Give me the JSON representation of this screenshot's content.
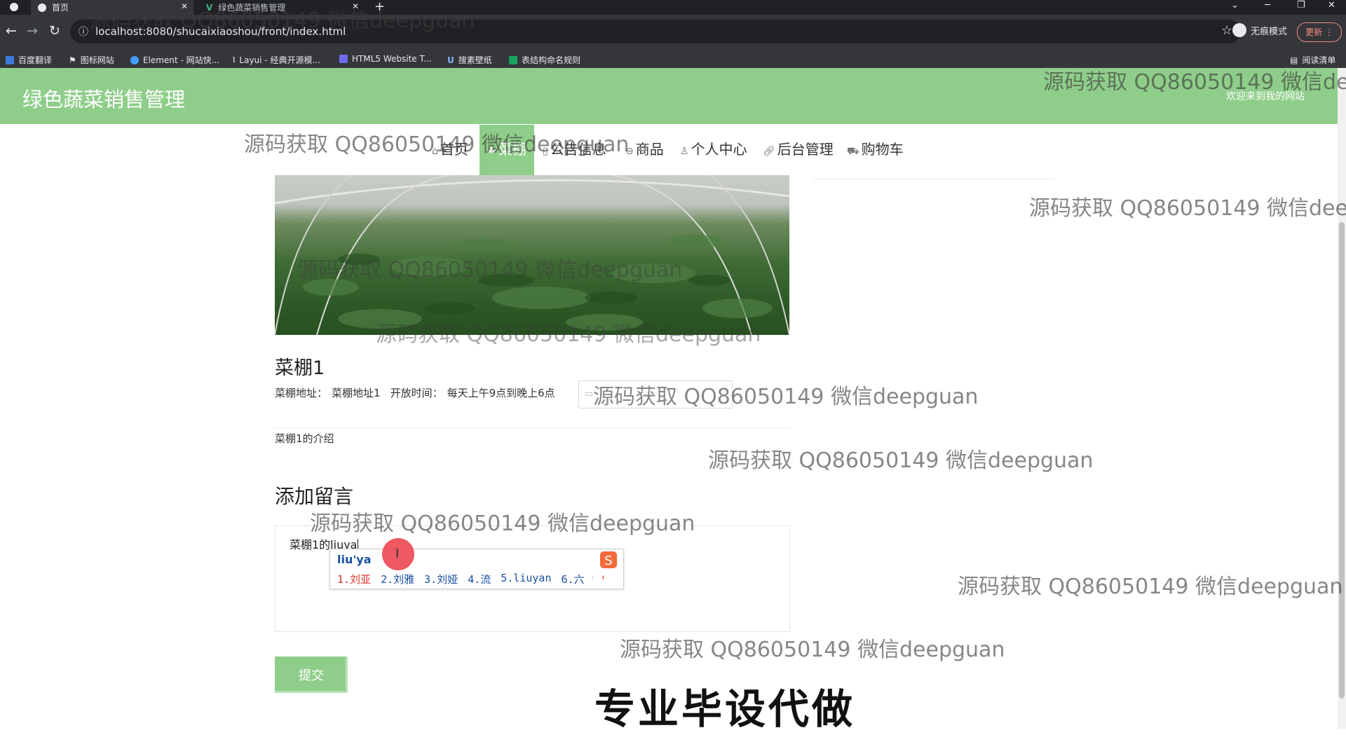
{
  "browser": {
    "tabs": [
      {
        "title": "首页",
        "active": true
      },
      {
        "title": "绿色蔬菜销售管理",
        "active": false
      }
    ],
    "url": "localhost:8080/shucaixiaoshou/front/index.html",
    "incognito_label": "无痕模式",
    "update_label": "更新",
    "reading_list_label": "阅读清单",
    "bookmarks": [
      {
        "label": "百度翻译",
        "color": "#3b7ddd"
      },
      {
        "label": "图标网站",
        "color": "#e8eaed"
      },
      {
        "label": "Element - 网站快...",
        "color": "#409eff"
      },
      {
        "label": "Layui - 经典开源模...",
        "color": "#e8eaed"
      },
      {
        "label": "HTML5 Website T...",
        "color": "#6c6cf0"
      },
      {
        "label": "搜素壁纸",
        "color": "#3367d6"
      },
      {
        "label": "表结构命名规则",
        "color": "#1aa260"
      }
    ]
  },
  "site": {
    "title": "绿色蔬菜销售管理",
    "welcome": "欢迎来到我的网站",
    "accent": "#8fce8a",
    "nav": [
      {
        "label": "首页",
        "icon": "home-icon",
        "active": false
      },
      {
        "label": "菜棚",
        "icon": "leaf-icon",
        "active": true
      },
      {
        "label": "公告信息",
        "icon": "book-icon",
        "active": false
      },
      {
        "label": "商品",
        "icon": "box-icon",
        "active": false
      },
      {
        "label": "个人中心",
        "icon": "user-icon",
        "active": false
      },
      {
        "label": "后台管理",
        "icon": "link-icon",
        "active": false
      },
      {
        "label": "购物车",
        "icon": "cart-icon",
        "active": false
      }
    ]
  },
  "detail": {
    "name": "菜棚1",
    "address_label": "菜棚地址：",
    "address_value": "菜棚地址1",
    "hours_label": "开放时间：",
    "hours_value": "每天上午9点到晚上6点",
    "intro": "菜棚1的介绍"
  },
  "message": {
    "title": "添加留言",
    "input_value": "菜棚1的liuya",
    "submit_label": "提交"
  },
  "ime": {
    "pinyin": "liu'ya",
    "candidates": [
      "1.刘亚",
      "2.刘雅",
      "3.刘娅",
      "4.流",
      "5.liuyan",
      "6.六"
    ]
  },
  "watermarks": [
    "源码获取 QQ86050149 微信deepguan",
    "源码获取 QQ86050149 微信dee",
    "源码获取 QQ86050149 微信dee"
  ],
  "promo": "专业毕设代做"
}
